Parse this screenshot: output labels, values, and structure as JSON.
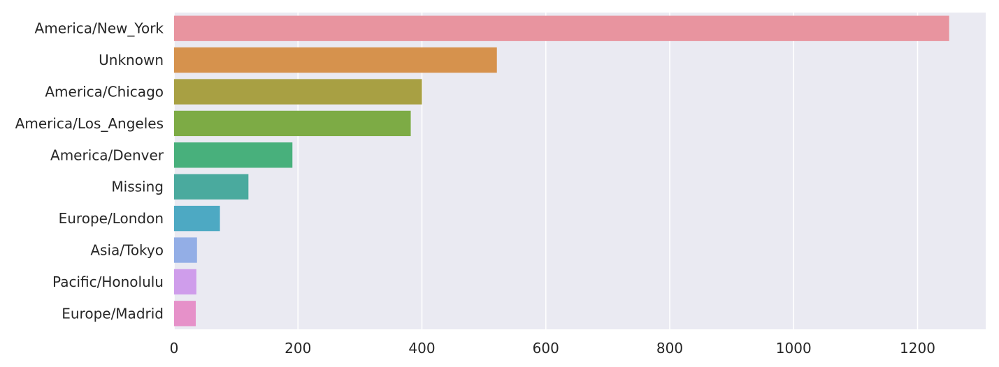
{
  "chart_data": {
    "type": "bar",
    "orientation": "horizontal",
    "title": "",
    "xlabel": "",
    "ylabel": "",
    "categories": [
      "America/New_York",
      "Unknown",
      "America/Chicago",
      "America/Los_Angeles",
      "America/Denver",
      "Missing",
      "Europe/London",
      "Asia/Tokyo",
      "Pacific/Honolulu",
      "Europe/Madrid"
    ],
    "values": [
      1251,
      521,
      400,
      382,
      191,
      120,
      74,
      37,
      36,
      35
    ],
    "colors": [
      "#e8949f",
      "#d6924d",
      "#a8a043",
      "#7dab45",
      "#48b07c",
      "#4aaa9e",
      "#4da9c3",
      "#93aee6",
      "#cf9deb",
      "#e691c9"
    ],
    "xlim": [
      0,
      1310
    ],
    "xticks": [
      0,
      200,
      400,
      600,
      800,
      1000,
      1200
    ],
    "xtick_labels": [
      "0",
      "200",
      "400",
      "600",
      "800",
      "1000",
      "1200"
    ],
    "grid": true,
    "grid_axis": "x",
    "background": "#eaeaf2",
    "grid_color": "#ffffff",
    "legend": "none"
  }
}
